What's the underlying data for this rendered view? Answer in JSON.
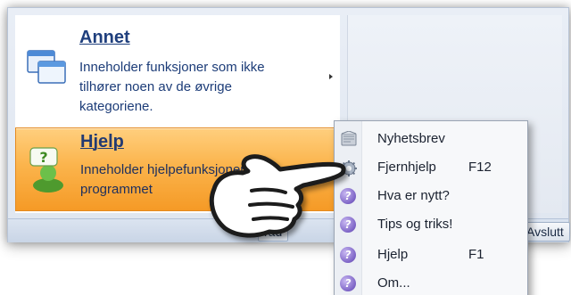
{
  "menu": {
    "entries": [
      {
        "id": "annet",
        "title": "Annet",
        "description_lines": [
          "Inneholder funksjoner som ikke",
          "tilhører noen av de øvrige",
          "kategoriene."
        ]
      },
      {
        "id": "hjelp",
        "title": "Hjelp",
        "description_lines": [
          "Inneholder hjelpefunksjoner i",
          "programmet"
        ]
      }
    ]
  },
  "bottom_bar": {
    "left_button_label": "råd",
    "right_button_label": "Avslutt"
  },
  "popup": {
    "items": [
      {
        "label": "Nyhetsbrev",
        "shortcut": "",
        "icon": "newsletter-icon"
      },
      {
        "label": "Fjernhjelp",
        "shortcut": "F12",
        "icon": "gear-icon"
      },
      {
        "label": "Hva er nytt?",
        "shortcut": "",
        "icon": "question-icon"
      },
      {
        "label": "Tips og triks!",
        "shortcut": "",
        "icon": "question-icon"
      },
      {
        "label": "Hjelp",
        "shortcut": "F1",
        "icon": "question-icon"
      },
      {
        "label": "Om...",
        "shortcut": "",
        "icon": "question-icon"
      }
    ]
  },
  "colors": {
    "highlight": "#f9a93a",
    "title_text": "#1f3f7d"
  }
}
